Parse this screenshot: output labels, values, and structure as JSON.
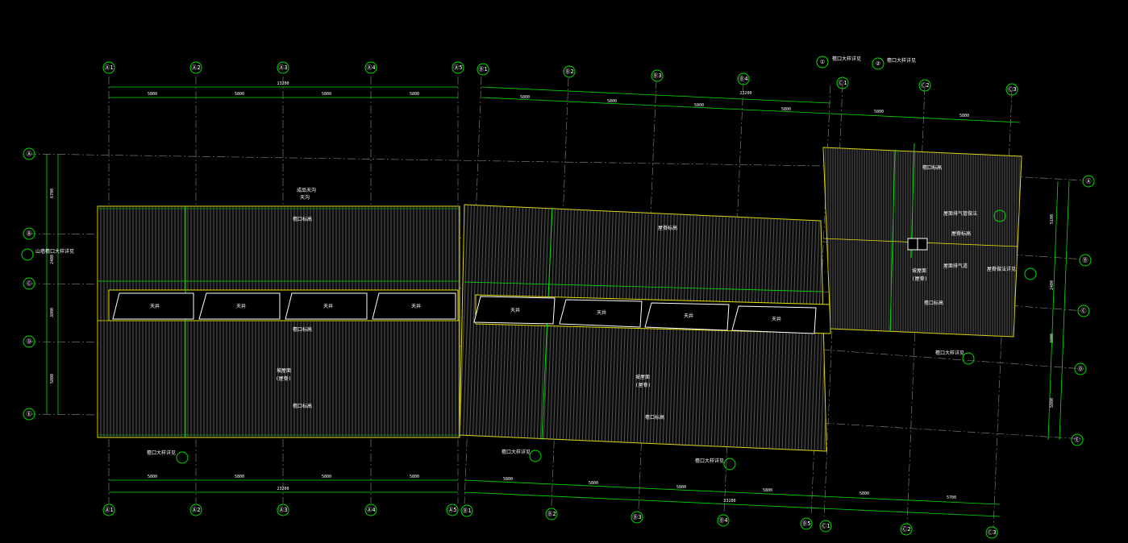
{
  "drawing": {
    "colors": {
      "background": "#000000",
      "axis": "#00e000",
      "grid": "#8a8a8a",
      "roof_edge": "#e8e000",
      "text": "#ffffff",
      "hatch": "#6f6f6f"
    },
    "top_axes_west": [
      "Ⓐ1",
      "Ⓐ2",
      "Ⓐ3",
      "Ⓐ4",
      "Ⓐ5"
    ],
    "top_axes_mid": [
      "Ⓑ1",
      "Ⓑ2",
      "Ⓑ3",
      "Ⓑ4"
    ],
    "top_axes_east": [
      "①",
      "②",
      "Ⓒ1",
      "Ⓒ2",
      "Ⓒ3"
    ],
    "bottom_axes": [
      "Ⓐ1",
      "Ⓐ2",
      "Ⓐ3",
      "Ⓐ4",
      "Ⓐ5",
      "Ⓑ1",
      "Ⓑ2",
      "Ⓑ3",
      "Ⓑ4",
      "Ⓑ5",
      "Ⓒ1",
      "Ⓒ2",
      "Ⓒ3"
    ],
    "left_axes": [
      "Ⓐ",
      "Ⓑ",
      "Ⓒ",
      "Ⓓ",
      "Ⓔ"
    ],
    "right_axes": [
      "Ⓐ",
      "Ⓑ",
      "Ⓒ",
      "Ⓓ",
      "Ⓔ"
    ],
    "dims_top_west": [
      "5800",
      "5800",
      "5800",
      "5800"
    ],
    "dims_top_west_total": "23200",
    "dims_top_mid": [
      "5800",
      "5800",
      "5800",
      "5800"
    ],
    "dims_top_mid_total": "23200",
    "dims_bottom_west": [
      "5800",
      "5800",
      "5800",
      "5800"
    ],
    "dims_bottom_west_total": "23200",
    "dims_bottom_mid": [
      "5800",
      "5800",
      "5800",
      "5800",
      "5800",
      "5700"
    ],
    "dims_bottom_mid_total": "23200",
    "dims_left": [
      "6700",
      "2400",
      "3800",
      "5800"
    ],
    "dims_right": [
      "5100",
      "2400",
      "3800",
      "5800"
    ],
    "skylight_label": "天井",
    "notes": {
      "roof_main": "坡屋面",
      "roof_main_sub": "(屋脊)",
      "gutter_top": "檐口标高",
      "gutter_bottom": "檐口标高",
      "ridge": "屋脊标高",
      "detail_left": "山墙檐口大样详见",
      "detail_bottom_1": "檐口大样详见",
      "detail_bottom_2": "檐口大样详见",
      "detail_bottom_3": "檐口大样详见",
      "detail_top_1": "檐口大样详见",
      "detail_top_2": "檐口大样详见",
      "east_roof": "坡屋面",
      "east_roof_sub": "(屋脊)",
      "east_note_1": "屋面排气管做法",
      "east_note_2": "屋面排气道",
      "east_note_3": "屋脊做法详见",
      "east_detail": "檐口大样详见",
      "top_label": "成品天沟",
      "top_label_2": "天沟"
    }
  }
}
